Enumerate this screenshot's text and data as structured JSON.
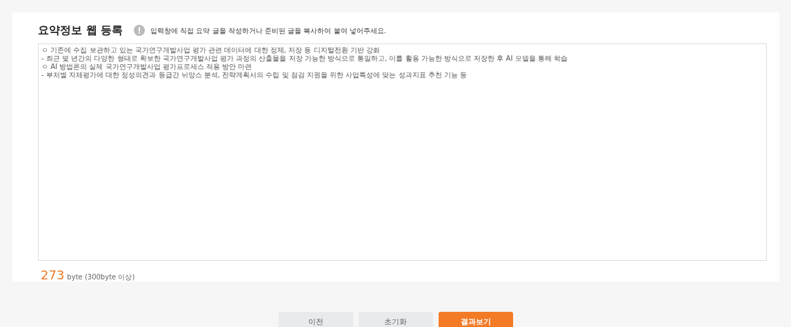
{
  "section": {
    "title": "요약정보 웹 등록",
    "hint": "입력창에 직접 요약 글을 작성하거나 준비된 글을 복사하여 붙여 넣어주세요."
  },
  "editor": {
    "lines": [
      "ㅇ 기존에 수집 보관하고 있는 국가연구개발사업 평가 관련 데이터에 대한 정제, 저장 등 디지털전환 기반 강화",
      "- 최근 몇 년간의 다양한 형태로 확보한 국가연구개발사업 평가 과정의 산출물을 저장 가능한 방식으로 통일하고, 이를 활용 가능한 방식으로 저장한 후 AI 모델을 통해 학습",
      "ㅇ AI 방법론의 실제 국가연구개발사업 평가프로세스 적용 방안 마련",
      "- 부처별 자체평가에 대한 정성의견과 등급간 뉘앙스 분석, 전략계획서의 수립 및 점검 지원을 위한 사업특성에 맞는 성과지표 추천 기능 등"
    ]
  },
  "byte_count": {
    "count": "273",
    "unit": "byte (300byte 이상)"
  },
  "buttons": [
    {
      "label": "이전",
      "kind": "secondary"
    },
    {
      "label": "초기화",
      "kind": "secondary"
    },
    {
      "label": "결과보기",
      "kind": "primary"
    }
  ]
}
